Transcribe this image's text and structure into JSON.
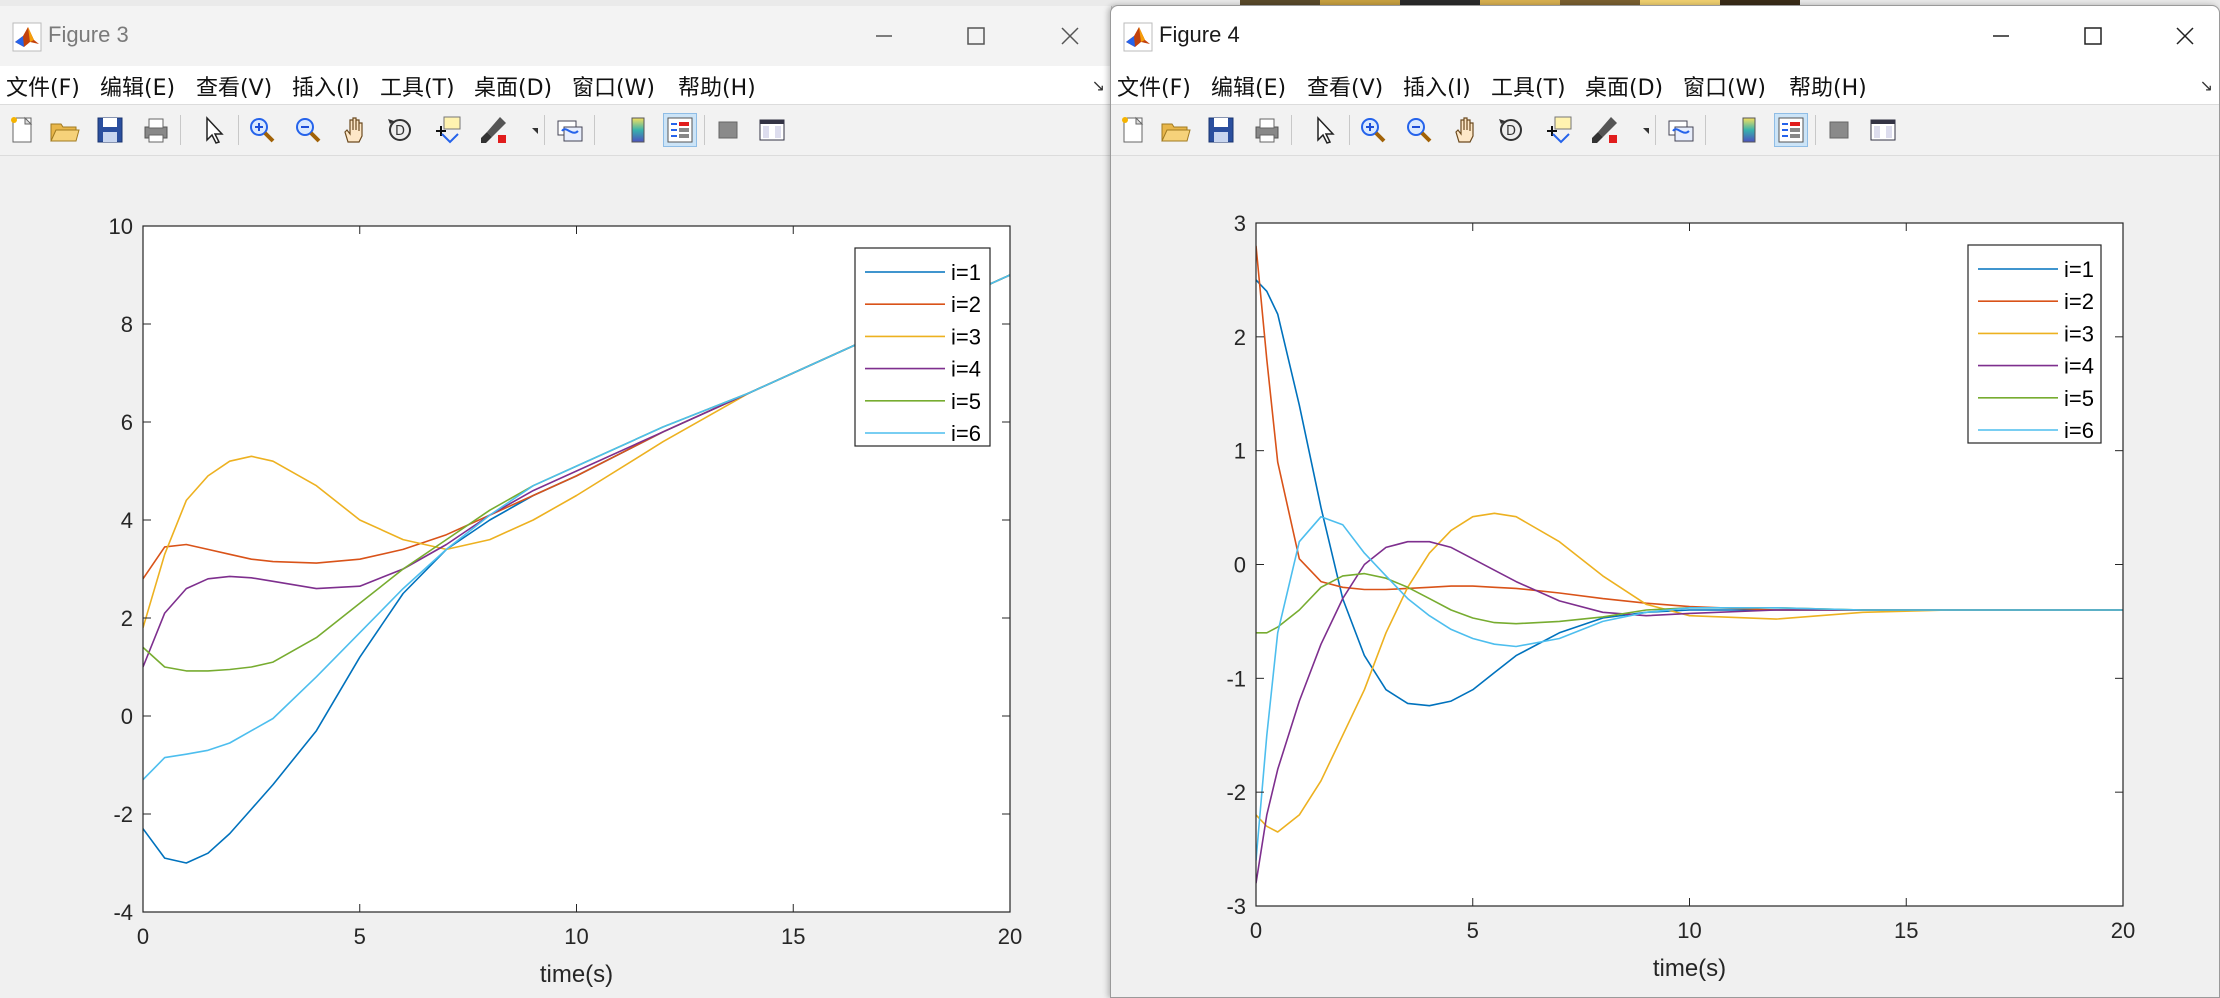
{
  "background_strip": {
    "colors": [
      "#5a4a2a",
      "#c8a040",
      "#2a2a2a",
      "#d8b050",
      "#7a6030",
      "#f0d070",
      "#3a2c18"
    ]
  },
  "windows": [
    {
      "title": "Figure 3",
      "menu": [
        "文件(F)",
        "编辑(E)",
        "查看(V)",
        "插入(I)",
        "工具(T)",
        "桌面(D)",
        "窗口(W)",
        "帮助(H)"
      ],
      "toolbar_icons": [
        "new-figure-icon",
        "open-file-icon",
        "save-icon",
        "print-icon",
        "pointer-icon",
        "zoom-in-icon",
        "zoom-out-icon",
        "pan-hand-icon",
        "rotate-3d-icon",
        "data-cursor-icon",
        "brush-icon",
        "brush-dropdown-icon",
        "link-plot-icon",
        "colorbar-icon",
        "legend-icon",
        "hide-plot-tools-icon",
        "show-plot-tools-icon"
      ],
      "chart_data": {
        "type": "line",
        "xlabel": "time(s)",
        "ylabel": "",
        "xlim": [
          0,
          20
        ],
        "ylim": [
          -4,
          10
        ],
        "xticks": [
          0,
          5,
          10,
          15,
          20
        ],
        "yticks": [
          -4,
          -2,
          0,
          2,
          4,
          6,
          8,
          10
        ],
        "grid": false,
        "legend_position": "top-right",
        "x": [
          0,
          0.5,
          1,
          1.5,
          2,
          2.5,
          3,
          4,
          5,
          6,
          7,
          8,
          9,
          10,
          12,
          14,
          16,
          18,
          20
        ],
        "series": [
          {
            "name": "i=1",
            "color": "#0072BD",
            "values": [
              -2.3,
              -2.9,
              -3.0,
              -2.8,
              -2.4,
              -1.9,
              -1.4,
              -0.3,
              1.2,
              2.5,
              3.4,
              4.0,
              4.5,
              4.9,
              5.8,
              6.6,
              7.4,
              8.2,
              9.0
            ]
          },
          {
            "name": "i=2",
            "color": "#D95319",
            "values": [
              2.8,
              3.45,
              3.5,
              3.4,
              3.3,
              3.2,
              3.15,
              3.12,
              3.2,
              3.4,
              3.7,
              4.1,
              4.5,
              4.9,
              5.8,
              6.6,
              7.4,
              8.2,
              9.0
            ]
          },
          {
            "name": "i=3",
            "color": "#EDB120",
            "values": [
              1.8,
              3.3,
              4.4,
              4.9,
              5.2,
              5.3,
              5.2,
              4.7,
              4.0,
              3.6,
              3.4,
              3.6,
              4.0,
              4.5,
              5.6,
              6.6,
              7.4,
              8.2,
              9.0
            ]
          },
          {
            "name": "i=4",
            "color": "#7E2F8E",
            "values": [
              1.0,
              2.1,
              2.6,
              2.8,
              2.85,
              2.82,
              2.75,
              2.6,
              2.65,
              3.0,
              3.5,
              4.1,
              4.6,
              5.0,
              5.8,
              6.6,
              7.4,
              8.2,
              9.0
            ]
          },
          {
            "name": "i=5",
            "color": "#77AC30",
            "values": [
              1.4,
              1.0,
              0.92,
              0.92,
              0.95,
              1.0,
              1.1,
              1.6,
              2.3,
              3.0,
              3.6,
              4.2,
              4.7,
              5.1,
              5.9,
              6.6,
              7.4,
              8.2,
              9.0
            ]
          },
          {
            "name": "i=6",
            "color": "#4DBEEE",
            "values": [
              -1.3,
              -0.85,
              -0.78,
              -0.7,
              -0.55,
              -0.3,
              -0.05,
              0.8,
              1.7,
              2.6,
              3.4,
              4.1,
              4.7,
              5.1,
              5.9,
              6.6,
              7.4,
              8.2,
              9.0
            ]
          }
        ]
      }
    },
    {
      "title": "Figure 4",
      "menu": [
        "文件(F)",
        "编辑(E)",
        "查看(V)",
        "插入(I)",
        "工具(T)",
        "桌面(D)",
        "窗口(W)",
        "帮助(H)"
      ],
      "toolbar_icons": [
        "new-figure-icon",
        "open-file-icon",
        "save-icon",
        "print-icon",
        "pointer-icon",
        "zoom-in-icon",
        "zoom-out-icon",
        "pan-hand-icon",
        "rotate-3d-icon",
        "data-cursor-icon",
        "brush-icon",
        "brush-dropdown-icon",
        "link-plot-icon",
        "colorbar-icon",
        "legend-icon",
        "hide-plot-tools-icon",
        "show-plot-tools-icon"
      ],
      "chart_data": {
        "type": "line",
        "xlabel": "time(s)",
        "ylabel": "",
        "xlim": [
          0,
          20
        ],
        "ylim": [
          -3,
          3
        ],
        "xticks": [
          0,
          5,
          10,
          15,
          20
        ],
        "yticks": [
          -3,
          -2,
          -1,
          0,
          1,
          2,
          3
        ],
        "grid": false,
        "legend_position": "top-right",
        "x": [
          0,
          0.25,
          0.5,
          1,
          1.5,
          2,
          2.5,
          3,
          3.5,
          4,
          4.5,
          5,
          5.5,
          6,
          7,
          8,
          9,
          10,
          12,
          14,
          16,
          18,
          20
        ],
        "series": [
          {
            "name": "i=1",
            "color": "#0072BD",
            "values": [
              2.5,
              2.4,
              2.2,
              1.4,
              0.5,
              -0.3,
              -0.8,
              -1.1,
              -1.22,
              -1.24,
              -1.2,
              -1.1,
              -0.95,
              -0.8,
              -0.6,
              -0.47,
              -0.42,
              -0.4,
              -0.4,
              -0.4,
              -0.4,
              -0.4,
              -0.4
            ]
          },
          {
            "name": "i=2",
            "color": "#D95319",
            "values": [
              2.8,
              1.8,
              0.9,
              0.05,
              -0.15,
              -0.2,
              -0.22,
              -0.22,
              -0.21,
              -0.2,
              -0.19,
              -0.19,
              -0.2,
              -0.21,
              -0.25,
              -0.3,
              -0.34,
              -0.37,
              -0.4,
              -0.4,
              -0.4,
              -0.4,
              -0.4
            ]
          },
          {
            "name": "i=3",
            "color": "#EDB120",
            "values": [
              -2.2,
              -2.3,
              -2.35,
              -2.2,
              -1.9,
              -1.5,
              -1.1,
              -0.6,
              -0.2,
              0.1,
              0.3,
              0.42,
              0.45,
              0.42,
              0.2,
              -0.1,
              -0.35,
              -0.45,
              -0.48,
              -0.42,
              -0.4,
              -0.4,
              -0.4
            ]
          },
          {
            "name": "i=4",
            "color": "#7E2F8E",
            "values": [
              -2.8,
              -2.2,
              -1.8,
              -1.2,
              -0.7,
              -0.3,
              0.0,
              0.15,
              0.2,
              0.2,
              0.15,
              0.05,
              -0.05,
              -0.15,
              -0.32,
              -0.42,
              -0.45,
              -0.43,
              -0.4,
              -0.4,
              -0.4,
              -0.4,
              -0.4
            ]
          },
          {
            "name": "i=5",
            "color": "#77AC30",
            "values": [
              -0.6,
              -0.6,
              -0.55,
              -0.4,
              -0.2,
              -0.1,
              -0.08,
              -0.12,
              -0.2,
              -0.3,
              -0.4,
              -0.47,
              -0.51,
              -0.52,
              -0.5,
              -0.46,
              -0.4,
              -0.38,
              -0.38,
              -0.4,
              -0.4,
              -0.4,
              -0.4
            ]
          },
          {
            "name": "i=6",
            "color": "#4DBEEE",
            "values": [
              -2.6,
              -1.5,
              -0.6,
              0.2,
              0.42,
              0.35,
              0.1,
              -0.1,
              -0.3,
              -0.45,
              -0.57,
              -0.65,
              -0.7,
              -0.72,
              -0.65,
              -0.5,
              -0.42,
              -0.38,
              -0.38,
              -0.4,
              -0.4,
              -0.4,
              -0.4
            ]
          }
        ]
      }
    }
  ]
}
